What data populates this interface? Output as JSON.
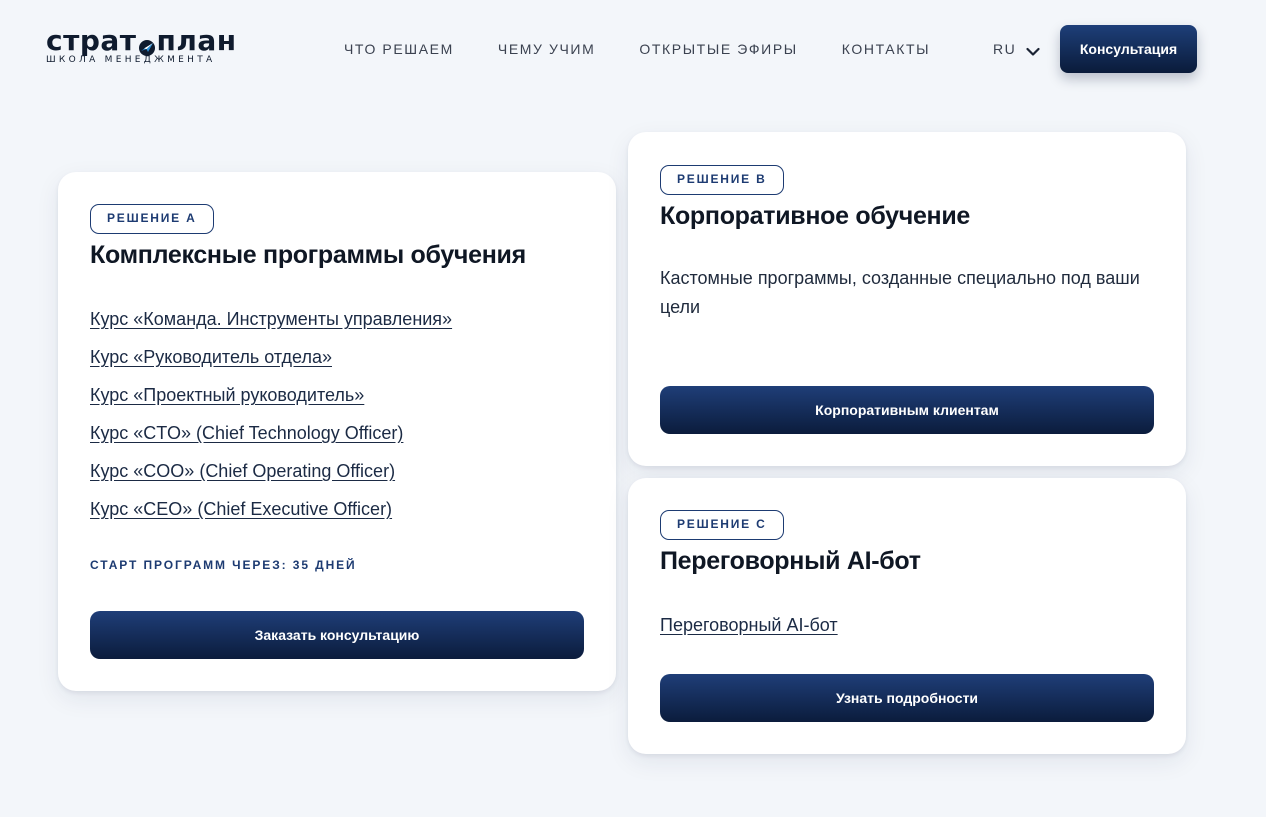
{
  "header": {
    "logo_word_left": "страт",
    "logo_word_right": "план",
    "logo_subtitle": "ШКОЛА МЕНЕДЖМЕНТА",
    "nav": [
      {
        "label": "ЧТО РЕШАЕМ"
      },
      {
        "label": "ЧЕМУ УЧИМ"
      },
      {
        "label": "ОТКРЫТЫЕ ЭФИРЫ"
      },
      {
        "label": "КОНТАКТЫ"
      }
    ],
    "language": "RU",
    "consult_button": "Консультация"
  },
  "colors": {
    "background": "#f3f6fa",
    "primary_navy": "#0b1c3c",
    "accent_blue": "#1d3b72",
    "logo_plane_accent": "#2b8fd6"
  },
  "solution_a": {
    "badge": "РЕШЕНИЕ A",
    "title": "Комплексные программы обучения",
    "courses": [
      "Курс «Команда. Инструменты управления»",
      "Курс «Руководитель отдела»",
      "Курс «Проектный руководитель»",
      "Курс «CTO» (Chief Technology Officer)",
      "Курс «COO» (Chief Operating Officer)",
      "Курс «CEO» (Chief Executive Officer)"
    ],
    "start_note": "СТАРТ ПРОГРАММ ЧЕРЕЗ: 35 ДНЕЙ",
    "button": "Заказать консультацию"
  },
  "solution_b": {
    "badge": "РЕШЕНИЕ B",
    "title": "Корпоративное обучение",
    "description": "Кастомные программы, созданные специально под ваши цели",
    "button": "Корпоративным клиентам"
  },
  "solution_c": {
    "badge": "РЕШЕНИЕ C",
    "title": "Переговорный AI-бот",
    "link": "Переговорный AI-бот",
    "button": "Узнать подробности"
  }
}
